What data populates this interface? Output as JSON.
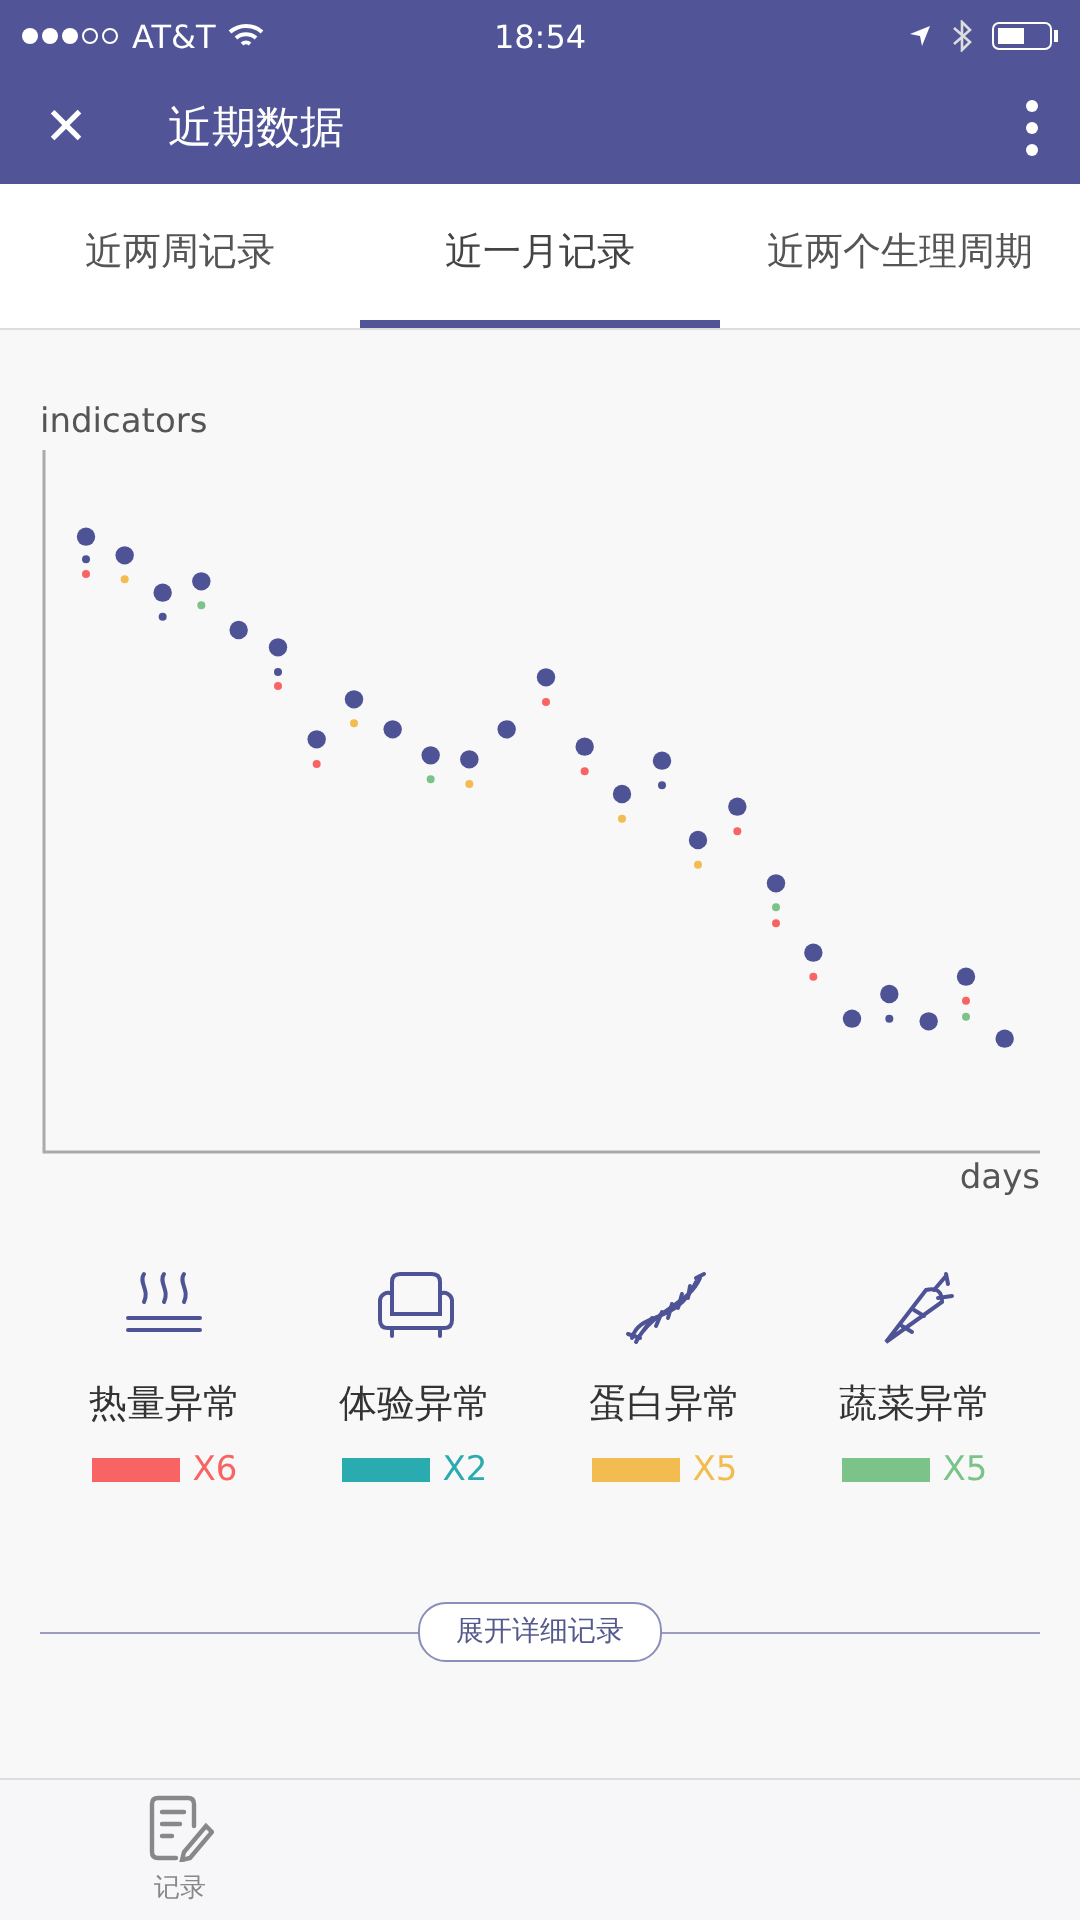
{
  "status_bar": {
    "carrier": "AT&T",
    "time": "18:54"
  },
  "nav": {
    "close": "✕",
    "title": "近期数据"
  },
  "tabs": [
    {
      "label": "近两周记录",
      "selected": false
    },
    {
      "label": "近一月记录",
      "selected": true
    },
    {
      "label": "近两个生理周期",
      "selected": false
    }
  ],
  "chart": {
    "ylabel": "indicators",
    "xlabel": "days"
  },
  "categories": [
    {
      "label": "热量异常",
      "count": "X6",
      "color": "#f86464"
    },
    {
      "label": "体验异常",
      "count": "X2",
      "color": "#2aabb0"
    },
    {
      "label": "蛋白异常",
      "count": "X5",
      "color": "#f2bc50"
    },
    {
      "label": "蔬菜异常",
      "count": "X5",
      "color": "#7cc38a"
    }
  ],
  "expand_button": "展开详细记录",
  "bottom_tabs": [
    {
      "label": "记录"
    }
  ]
}
